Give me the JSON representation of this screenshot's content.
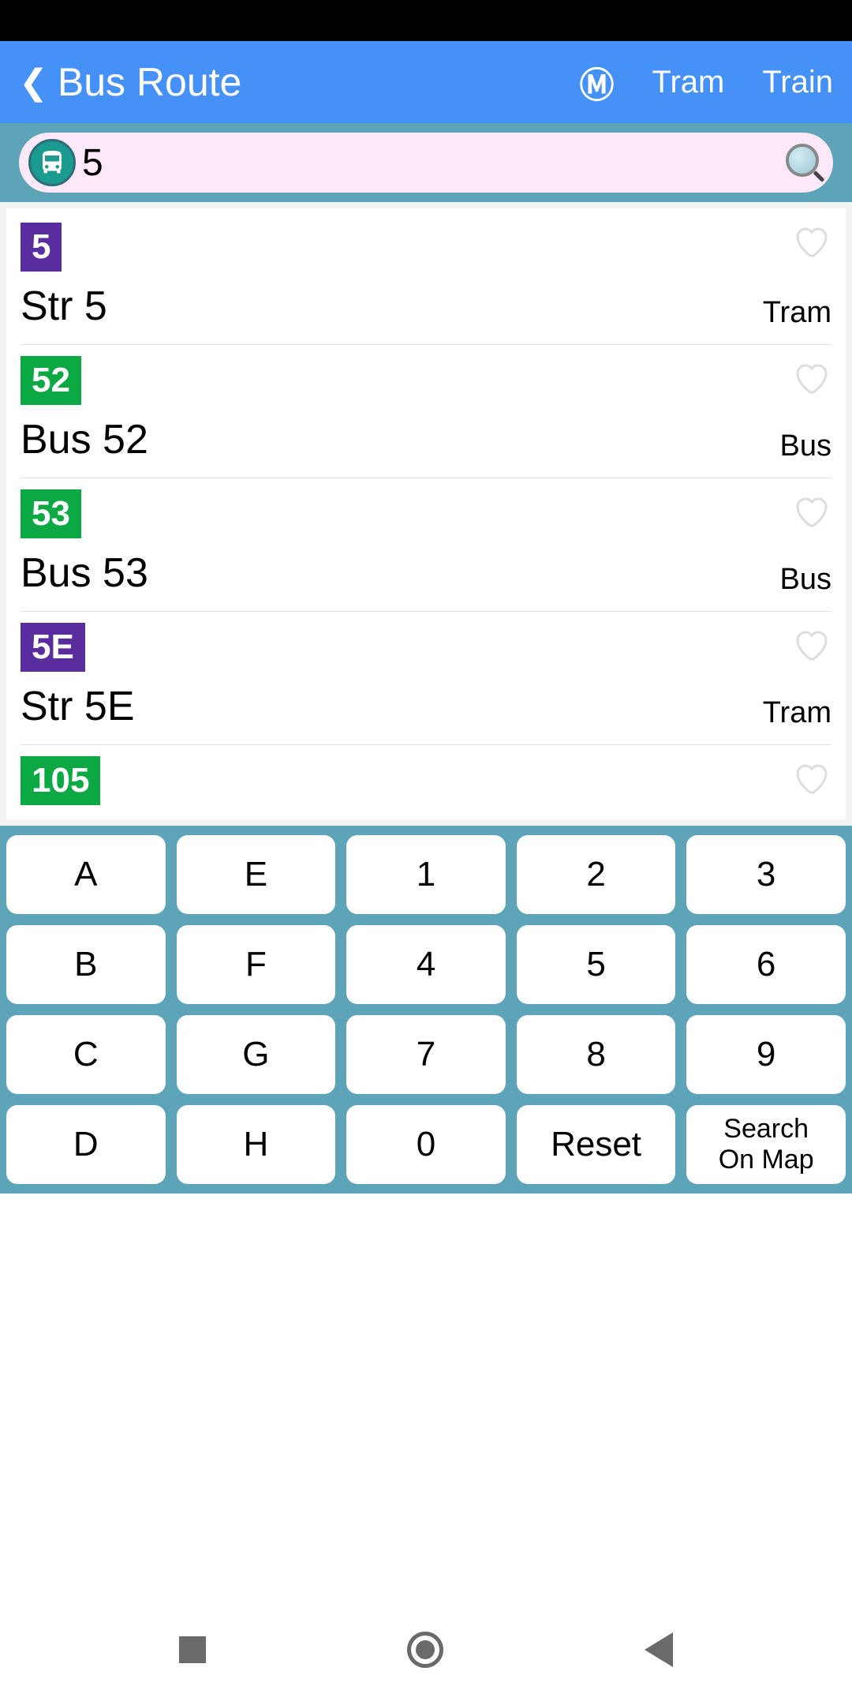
{
  "header": {
    "title": "Bus Route",
    "tram": "Tram",
    "train": "Train"
  },
  "search": {
    "value": "5"
  },
  "results": [
    {
      "badge": "5",
      "badge_color": "purple",
      "name": "Str 5",
      "type": "Tram"
    },
    {
      "badge": "52",
      "badge_color": "green",
      "name": "Bus 52",
      "type": "Bus"
    },
    {
      "badge": "53",
      "badge_color": "green",
      "name": "Bus 53",
      "type": "Bus"
    },
    {
      "badge": "5E",
      "badge_color": "purple",
      "name": "Str 5E",
      "type": "Tram"
    },
    {
      "badge": "105",
      "badge_color": "green",
      "name": "",
      "type": ""
    }
  ],
  "keys": {
    "r0c0": "A",
    "r0c1": "E",
    "r0c2": "1",
    "r0c3": "2",
    "r0c4": "3",
    "r1c0": "B",
    "r1c1": "F",
    "r1c2": "4",
    "r1c3": "5",
    "r1c4": "6",
    "r2c0": "C",
    "r2c1": "G",
    "r2c2": "7",
    "r2c3": "8",
    "r2c4": "9",
    "r3c0": "D",
    "r3c1": "H",
    "r3c2": "0",
    "r3c3": "Reset",
    "r3c4": "Search\nOn Map"
  }
}
